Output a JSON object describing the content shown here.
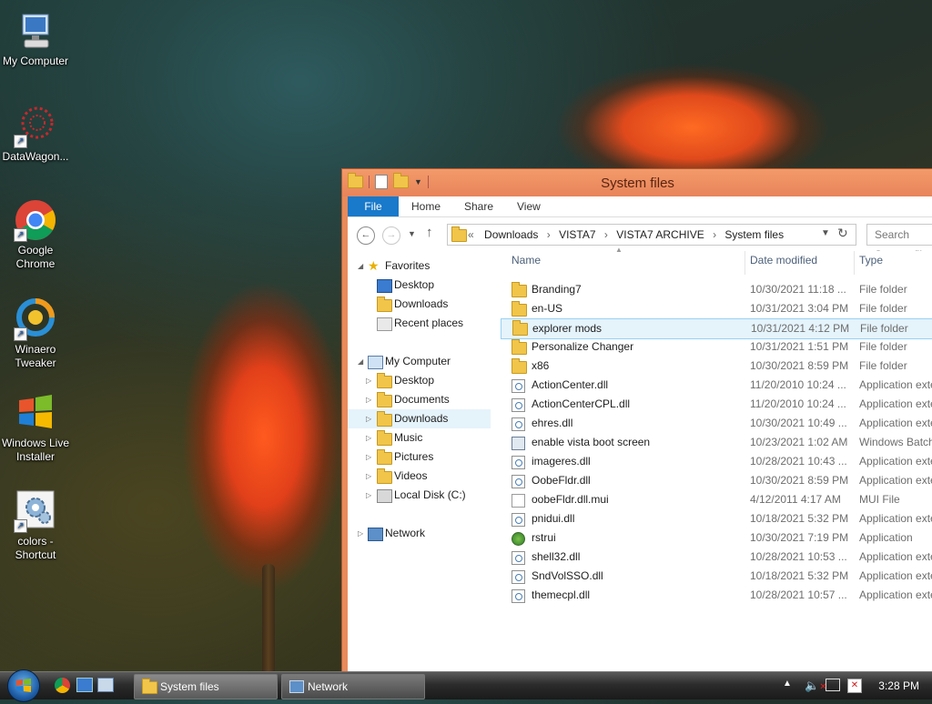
{
  "desktop": {
    "icons": [
      {
        "label": "My Computer"
      },
      {
        "label": "DataWagon..."
      },
      {
        "label": "Google Chrome"
      },
      {
        "label": "Winaero Tweaker"
      },
      {
        "label": "Windows Live Installer"
      },
      {
        "label": "colors - Shortcut"
      }
    ]
  },
  "window": {
    "title": "System files",
    "ribbon_tabs": [
      "File",
      "Home",
      "Share",
      "View"
    ],
    "address": {
      "prefix": "«",
      "crumbs": [
        "Downloads",
        "VISTA7",
        "VISTA7 ARCHIVE",
        "System files"
      ]
    },
    "search_placeholder": "Search System files",
    "nav": {
      "favorites": {
        "label": "Favorites",
        "items": [
          "Desktop",
          "Downloads",
          "Recent places"
        ]
      },
      "computer": {
        "label": "My Computer",
        "items": [
          "Desktop",
          "Documents",
          "Downloads",
          "Music",
          "Pictures",
          "Videos",
          "Local Disk (C:)"
        ]
      },
      "network": {
        "label": "Network"
      }
    },
    "columns": [
      "Name",
      "Date modified",
      "Type"
    ],
    "files": [
      {
        "name": "Branding7",
        "date": "10/30/2021 11:18 ...",
        "type": "File folder"
      },
      {
        "name": "en-US",
        "date": "10/31/2021 3:04 PM",
        "type": "File folder"
      },
      {
        "name": "explorer mods",
        "date": "10/31/2021 4:12 PM",
        "type": "File folder"
      },
      {
        "name": "Personalize Changer",
        "date": "10/31/2021 1:51 PM",
        "type": "File folder"
      },
      {
        "name": "x86",
        "date": "10/30/2021 8:59 PM",
        "type": "File folder"
      },
      {
        "name": "ActionCenter.dll",
        "date": "11/20/2010 10:24 ...",
        "type": "Application exte"
      },
      {
        "name": "ActionCenterCPL.dll",
        "date": "11/20/2010 10:24 ...",
        "type": "Application exte"
      },
      {
        "name": "ehres.dll",
        "date": "10/30/2021 10:49 ...",
        "type": "Application exte"
      },
      {
        "name": "enable vista boot screen",
        "date": "10/23/2021 1:02 AM",
        "type": "Windows Batch"
      },
      {
        "name": "imageres.dll",
        "date": "10/28/2021 10:43 ...",
        "type": "Application exte"
      },
      {
        "name": "OobeFldr.dll",
        "date": "10/30/2021 8:59 PM",
        "type": "Application exte"
      },
      {
        "name": "oobeFldr.dll.mui",
        "date": "4/12/2011 4:17 AM",
        "type": "MUI File"
      },
      {
        "name": "pnidui.dll",
        "date": "10/18/2021 5:32 PM",
        "type": "Application exte"
      },
      {
        "name": "rstrui",
        "date": "10/30/2021 7:19 PM",
        "type": "Application"
      },
      {
        "name": "shell32.dll",
        "date": "10/28/2021 10:53 ...",
        "type": "Application exte"
      },
      {
        "name": "SndVolSSO.dll",
        "date": "10/18/2021 5:32 PM",
        "type": "Application exte"
      },
      {
        "name": "themecpl.dll",
        "date": "10/28/2021 10:57 ...",
        "type": "Application exte"
      }
    ]
  },
  "taskbar": {
    "buttons": [
      "System files",
      "Network"
    ],
    "clock": "3:28 PM"
  }
}
